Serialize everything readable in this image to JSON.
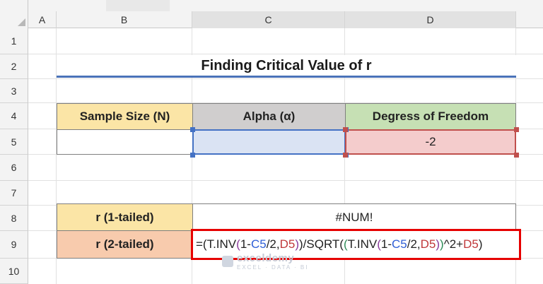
{
  "columns": [
    "A",
    "B",
    "C",
    "D"
  ],
  "rows": [
    "1",
    "2",
    "3",
    "4",
    "5",
    "6",
    "7",
    "8",
    "9",
    "10"
  ],
  "title": "Finding Critical Value of r",
  "table1": {
    "headers": [
      "Sample Size (N)",
      "Alpha (α)",
      "Degress of Freedom"
    ],
    "values": [
      "",
      "",
      "-2"
    ]
  },
  "table2": {
    "labels": [
      "r (1-tailed)",
      "r (2-tailed)"
    ],
    "result": "#NUM!",
    "formula_parts": [
      {
        "text": "=(T.INV",
        "color": "black"
      },
      {
        "text": "(",
        "color": "purple"
      },
      {
        "text": "1-",
        "color": "black"
      },
      {
        "text": "C5",
        "color": "blue"
      },
      {
        "text": "/2,",
        "color": "black"
      },
      {
        "text": "D5",
        "color": "red"
      },
      {
        "text": ")",
        "color": "purple"
      },
      {
        "text": ")/SQRT(",
        "color": "black"
      },
      {
        "text": "(",
        "color": "green"
      },
      {
        "text": "T.INV",
        "color": "black"
      },
      {
        "text": "(",
        "color": "purple"
      },
      {
        "text": "1-",
        "color": "black"
      },
      {
        "text": "C5",
        "color": "blue"
      },
      {
        "text": "/2,",
        "color": "black"
      },
      {
        "text": "D5",
        "color": "red"
      },
      {
        "text": ")",
        "color": "purple"
      },
      {
        "text": ")",
        "color": "green"
      },
      {
        "text": "^2+",
        "color": "black"
      },
      {
        "text": "D5",
        "color": "red"
      },
      {
        "text": ")",
        "color": "black"
      }
    ]
  },
  "watermark": {
    "brand": "exceldemy",
    "tagline": "EXCEL · DATA · BI"
  },
  "colors": {
    "header_yellow": "#fbe5a6",
    "header_gray": "#d0cece",
    "header_green": "#c6e0b4",
    "alpha_fill": "#dae3f3",
    "dof_fill": "#f4cccc",
    "label_orange": "#f8cbad",
    "label_yellow": "#fbe5a6",
    "formula_border": "#e60000",
    "title_underline": "#4a72b8"
  }
}
